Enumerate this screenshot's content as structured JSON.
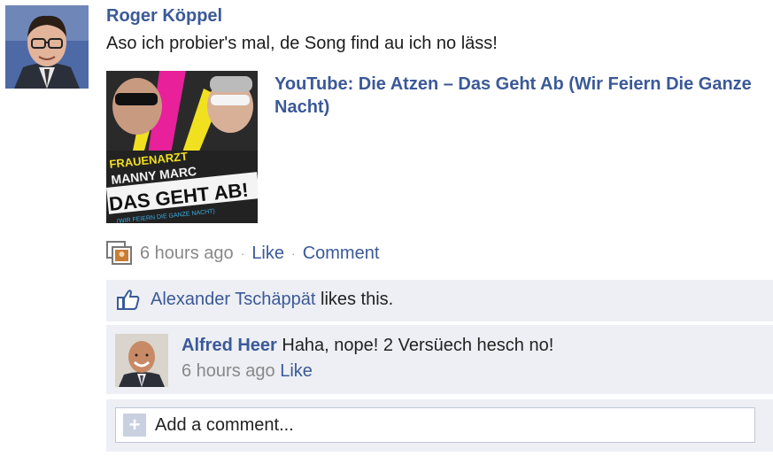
{
  "post": {
    "author": "Roger Köppel",
    "message": "Aso ich probier's mal, de Song find au ich no läss!",
    "link_title": "YouTube: Die Atzen – Das Geht Ab (Wir Feiern Die Ganze Nacht)",
    "thumbnail": {
      "lines": [
        "FRAUENARZT",
        "MANNY MARC",
        "DAS GEHT AB!",
        "(WIR FEIERN DIE GANZE NACHT)"
      ]
    },
    "timestamp": "6 hours ago",
    "separator": "·",
    "like_label": "Like",
    "comment_label": "Comment"
  },
  "likes": {
    "name": "Alexander Tschäppät",
    "suffix": " likes this."
  },
  "comment": {
    "author": "Alfred Heer",
    "text": " Haha, nope! 2 Versüech hesch no!",
    "timestamp": "6 hours ago",
    "like_label": "Like"
  },
  "add_comment": {
    "placeholder": "Add a comment..."
  },
  "colors": {
    "link": "#3b5998",
    "panel": "#edeff4",
    "muted": "#888888"
  }
}
